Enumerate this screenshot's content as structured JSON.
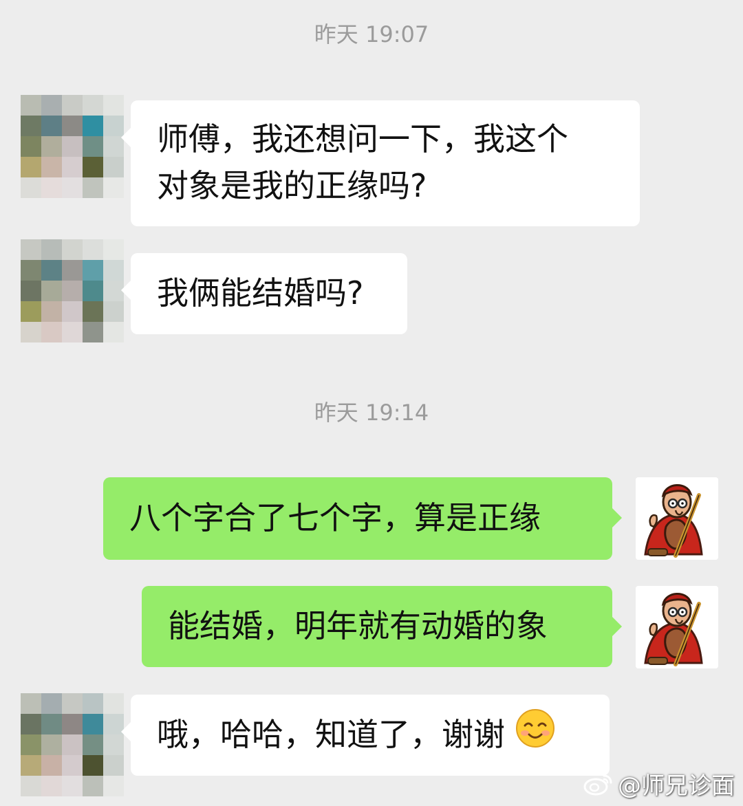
{
  "chat": {
    "timestamps": [
      "昨天 19:07",
      "昨天 19:14"
    ],
    "messages": [
      {
        "side": "in",
        "text": "师傅，我还想问一下，我这个\n对象是我的正缘吗?"
      },
      {
        "side": "in",
        "text": "我俩能结婚吗?"
      },
      {
        "side": "out",
        "text": "八个字合了七个字，算是正缘"
      },
      {
        "side": "out",
        "text": "能结婚，明年就有动婚的象"
      },
      {
        "side": "in",
        "text": "哦，哈哈，知道了，谢谢",
        "emoji": "smiling-face-emoji"
      }
    ]
  },
  "watermark": {
    "text": "@师兄诊面",
    "icon": "weibo-icon"
  },
  "colors": {
    "background": "#ededed",
    "incoming_bubble": "#ffffff",
    "outgoing_bubble": "#95ec69",
    "timestamp": "#9b9b9b"
  }
}
